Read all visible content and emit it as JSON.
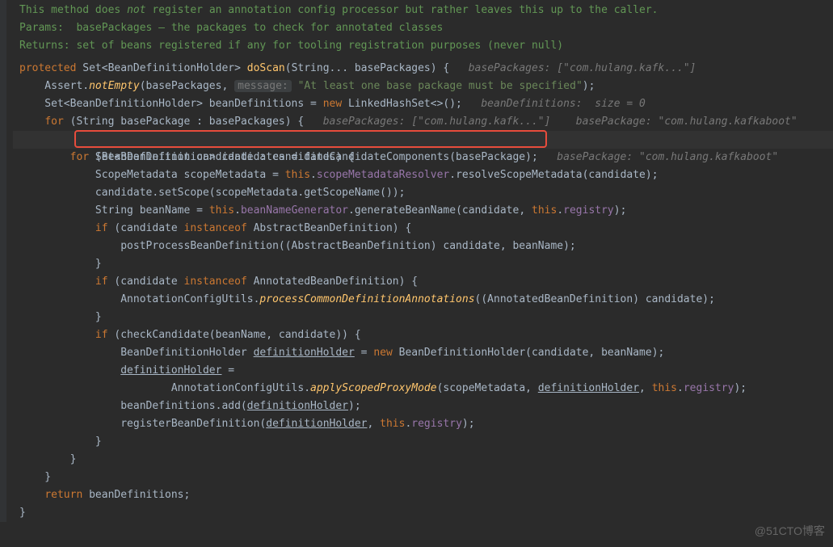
{
  "doc": {
    "line1_a": "This method does ",
    "line1_not": "not",
    "line1_b": " register an annotation config processor but rather leaves this up to the caller.",
    "line2": "Params:  basePackages – the packages to check for annotated classes",
    "line3_a": "Returns: set of beans registered if any for tooling registration purposes (never ",
    "line3_b": "null",
    "line3_c": ")"
  },
  "code": {
    "l1": {
      "protected": "protected",
      "type": " Set<BeanDefinitionHolder> ",
      "method": "doScan",
      "params": "(String... basePackages) {   ",
      "hint": "basePackages: [\"com.hulang.kafk...\"]"
    },
    "l2": {
      "indent": "    Assert.",
      "method": "notEmpty",
      "args": "(basePackages, ",
      "hintbox": "message:",
      "space": " ",
      "str": "\"At least one base package must be specified\"",
      "end": ");"
    },
    "l3": {
      "indent": "    Set<BeanDefinitionHolder> beanDefinitions = ",
      "new": "new",
      "type": " LinkedHashSet<>();   ",
      "hint": "beanDefinitions:  size = 0"
    },
    "l4": {
      "indent": "    ",
      "for": "for",
      "mid": " (String basePackage : basePackages) {   ",
      "hint1": "basePackages: [\"com.hulang.kafk...\"]",
      "gap": "    ",
      "hint2": "basePackage: \"com.hulang.kafkaboot\""
    },
    "l5": {
      "indent": "        Set<BeanDefinition> candidates = findCandidateComponents(basePackage);   ",
      "hint": "basePackage: \"com.hulang.kafkaboot\""
    },
    "l6": {
      "indent": "        ",
      "for": "for",
      "mid": " (BeanDefinition candidate : candidates) {"
    },
    "l7": {
      "indent": "            ScopeMetadata scopeMetadata = ",
      "this": "this",
      "dot": ".",
      "field": "scopeMetadataResolver",
      "rest": ".resolveScopeMetadata(candidate);"
    },
    "l8": {
      "indent": "            candidate.setScope(scopeMetadata.getScopeName());"
    },
    "l9": {
      "indent": "            String beanName = ",
      "this": "this",
      "dot": ".",
      "field": "beanNameGenerator",
      "mid": ".generateBeanName(candidate, ",
      "this2": "this",
      "dot2": ".",
      "field2": "registry",
      "end": ");"
    },
    "l10": {
      "indent": "            ",
      "if": "if",
      "mid": " (candidate ",
      "instanceof": "instanceof",
      "rest": " AbstractBeanDefinition) {"
    },
    "l11": {
      "indent": "                postProcessBeanDefinition((AbstractBeanDefinition) candidate, beanName);"
    },
    "l12": {
      "indent": "            }"
    },
    "l13": {
      "indent": "            ",
      "if": "if",
      "mid": " (candidate ",
      "instanceof": "instanceof",
      "rest": " AnnotatedBeanDefinition) {"
    },
    "l14": {
      "indent": "                AnnotationConfigUtils.",
      "method": "processCommonDefinitionAnnotations",
      "rest": "((AnnotatedBeanDefinition) candidate);"
    },
    "l15": {
      "indent": "            }"
    },
    "l16": {
      "indent": "            ",
      "if": "if",
      "mid": " (checkCandidate(beanName, candidate)) {"
    },
    "l17": {
      "indent": "                BeanDefinitionHolder ",
      "var": "definitionHolder",
      "mid": " = ",
      "new": "new",
      "rest": " BeanDefinitionHolder(candidate, beanName);"
    },
    "l18": {
      "indent": "                ",
      "var": "definitionHolder",
      "rest": " ="
    },
    "l19": {
      "indent": "                        AnnotationConfigUtils.",
      "method": "applyScopedProxyMode",
      "mid": "(scopeMetadata, ",
      "var": "definitionHolder",
      "c": ", ",
      "this": "this",
      "dot": ".",
      "field": "registry",
      "end": ");"
    },
    "l20": {
      "indent": "                beanDefinitions.add(",
      "var": "definitionHolder",
      "end": ");"
    },
    "l21": {
      "indent": "                registerBeanDefinition(",
      "var": "definitionHolder",
      "c": ", ",
      "this": "this",
      "dot": ".",
      "field": "registry",
      "end": ");"
    },
    "l22": {
      "indent": "            }"
    },
    "l23": {
      "indent": "        }"
    },
    "l24": {
      "indent": "    }"
    },
    "l25": {
      "indent": "    ",
      "return": "return",
      "rest": " beanDefinitions;"
    },
    "l26": {
      "indent": "}"
    }
  },
  "watermark": "@51CTO博客"
}
